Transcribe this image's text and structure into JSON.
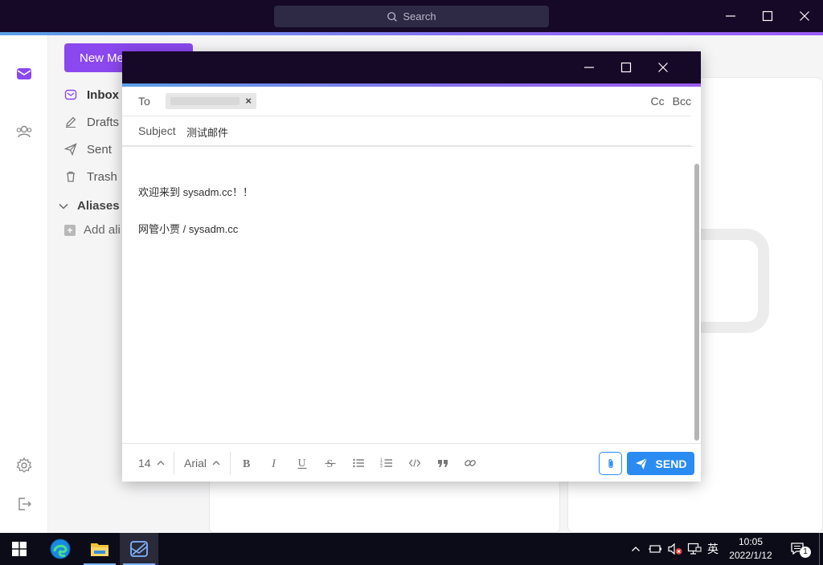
{
  "app": {
    "search_placeholder": "Search"
  },
  "sidebar": {
    "new_message_label": "New Me",
    "folders": [
      {
        "label": "Inbox",
        "icon": "inbox-icon",
        "active": true
      },
      {
        "label": "Drafts",
        "icon": "pencil-icon",
        "active": false
      },
      {
        "label": "Sent",
        "icon": "paper-plane-icon",
        "active": false
      },
      {
        "label": "Trash",
        "icon": "trash-icon",
        "active": false
      }
    ],
    "aliases_label": "Aliases",
    "add_alias_label": "Add ali"
  },
  "compose": {
    "to_label": "To",
    "recipient_chip_remove": "×",
    "cc_label": "Cc",
    "bcc_label": "Bcc",
    "subject_label": "Subject",
    "subject_value": "测试邮件",
    "body_lines": [
      "欢迎来到 sysadm.cc！！",
      "网管小贾 / sysadm.cc"
    ],
    "toolbar": {
      "font_size": "14",
      "font_family": "Arial",
      "send_label": "SEND"
    }
  },
  "taskbar": {
    "ime_label": "英",
    "time": "10:05",
    "date": "2022/1/12",
    "notification_count": "1"
  },
  "colors": {
    "accent_purple": "#8b48ee",
    "send_blue": "#2a8cf0",
    "titlebar_dark": "#160827"
  }
}
